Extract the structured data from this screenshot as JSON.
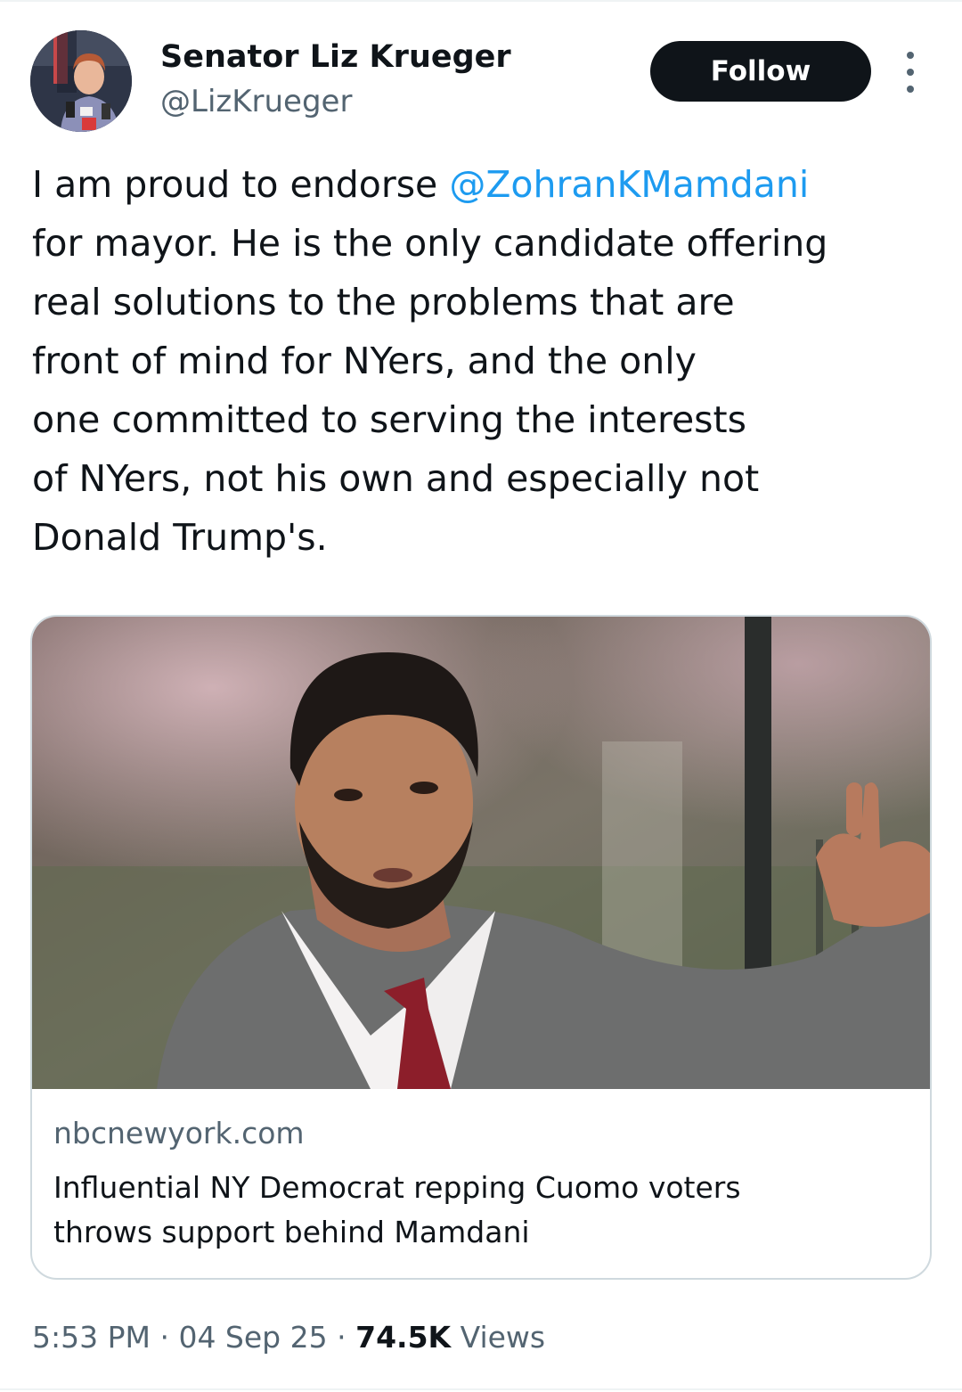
{
  "author": {
    "display_name": "Senator Liz Krueger",
    "handle": "@LizKrueger"
  },
  "follow_label": "Follow",
  "more_icon": "more-vertical-icon",
  "tweet": {
    "line1_text": "I am proud to endorse ",
    "mention": "@ZohranKMamdani",
    "line2": "for mayor. He is the only candidate offering",
    "line3": "real solutions to the problems that are",
    "line4": "front of mind for NYers, and the only",
    "line5": "one committed to serving the interests",
    "line6": "of NYers, not his own and especially not",
    "line7": "Donald Trump's."
  },
  "card": {
    "domain": "nbcnewyork.com",
    "title_line1": "Influential NY Democrat repping Cuomo voters",
    "title_line2": "throws support behind Mamdani"
  },
  "meta": {
    "time": "5:53 PM",
    "sep1": " · ",
    "date": "04 Sep 25",
    "sep2": " · ",
    "views_count": "74.5K",
    "views_label": " Views"
  },
  "colors": {
    "text": "#0f1419",
    "secondary": "#536471",
    "link": "#1d9bf0",
    "button": "#0f1419",
    "border": "#cfd9de"
  }
}
